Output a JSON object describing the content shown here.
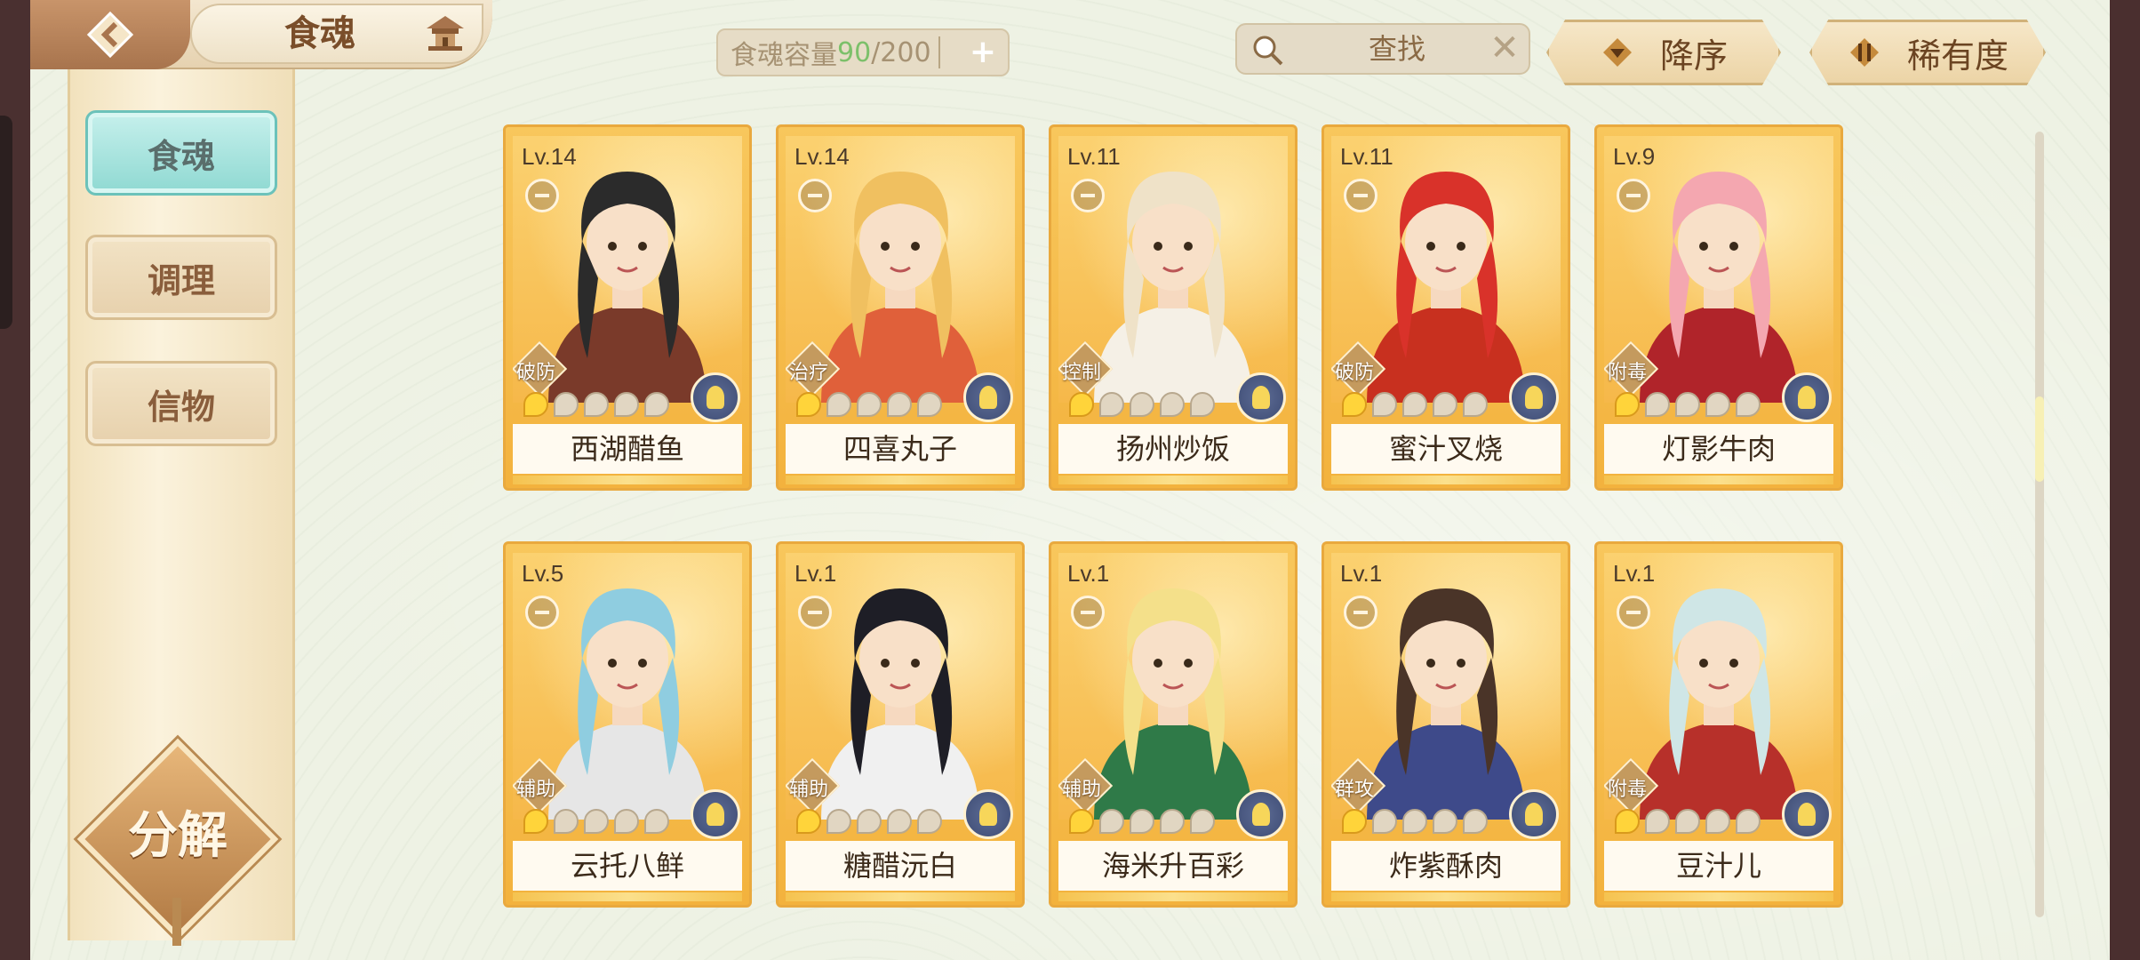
{
  "header": {
    "title": "食魂",
    "back_icon": "back-arrow-icon",
    "home_icon": "pavilion-home-icon"
  },
  "capacity": {
    "label": "食魂容量",
    "current": "90",
    "total": "/200",
    "plus": "+"
  },
  "search": {
    "label": "查找",
    "clear": "✕"
  },
  "sort": {
    "order_label": "降序",
    "rarity_label": "稀有度"
  },
  "sidebar": {
    "tabs": [
      {
        "label": "食魂",
        "active": true
      },
      {
        "label": "调理",
        "active": false
      },
      {
        "label": "信物",
        "active": false
      }
    ],
    "decompose_label": "分解"
  },
  "cards": [
    {
      "level": "Lv.14",
      "role": "破防",
      "name": "西湖醋鱼",
      "stars": 1,
      "hair": "#2b2b2b",
      "outfit": "#7a3a2a"
    },
    {
      "level": "Lv.14",
      "role": "治疗",
      "name": "四喜丸子",
      "stars": 1,
      "hair": "#f0c060",
      "outfit": "#e0603a"
    },
    {
      "level": "Lv.11",
      "role": "控制",
      "name": "扬州炒饭",
      "stars": 1,
      "hair": "#efe2c8",
      "outfit": "#f5f0e6"
    },
    {
      "level": "Lv.11",
      "role": "破防",
      "name": "蜜汁叉烧",
      "stars": 1,
      "hair": "#d9322a",
      "outfit": "#c8301f"
    },
    {
      "level": "Lv.9",
      "role": "附毒",
      "name": "灯影牛肉",
      "stars": 1,
      "hair": "#f4a7b0",
      "outfit": "#b0242a"
    },
    {
      "level": "Lv.5",
      "role": "辅助",
      "name": "云托八鲜",
      "stars": 1,
      "hair": "#8fcde0",
      "outfit": "#e6e6e6"
    },
    {
      "level": "Lv.1",
      "role": "辅助",
      "name": "糖醋沅白",
      "stars": 1,
      "hair": "#1e1e26",
      "outfit": "#f0f0f0"
    },
    {
      "level": "Lv.1",
      "role": "辅助",
      "name": "海米升百彩",
      "stars": 1,
      "hair": "#f4e08a",
      "outfit": "#2f7a48"
    },
    {
      "level": "Lv.1",
      "role": "群攻",
      "name": "炸紫酥肉",
      "stars": 1,
      "hair": "#4a3428",
      "outfit": "#3e4a8a"
    },
    {
      "level": "Lv.1",
      "role": "附毒",
      "name": "豆汁儿",
      "stars": 1,
      "hair": "#cfe6e6",
      "outfit": "#b7302a"
    }
  ]
}
